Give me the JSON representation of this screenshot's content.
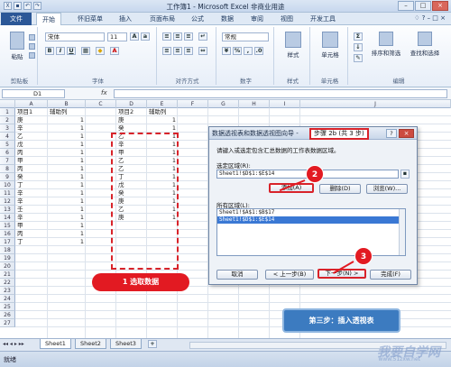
{
  "window": {
    "title": "工作簿1 - Microsoft Excel 非商业用途"
  },
  "ribbon_tabs": [
    "文件",
    "开始",
    "怀旧菜单",
    "插入",
    "页面布局",
    "公式",
    "数据",
    "审阅",
    "视图",
    "开发工具"
  ],
  "ribbon_groups": [
    "剪贴板",
    "字体",
    "对齐方式",
    "数字",
    "样式",
    "单元格",
    "编辑"
  ],
  "ribbon_buttons": {
    "paste": "粘贴",
    "font_name": "宋体",
    "font_size": "11",
    "number_format": "常规",
    "styles": "样式",
    "cells": "单元格",
    "sort_filter": "排序和筛选",
    "find_select": "查找和选择"
  },
  "formula_bar": {
    "name_box": "D1",
    "fx": "fx",
    "content": ""
  },
  "columns": [
    "A",
    "B",
    "C",
    "D",
    "E",
    "F",
    "G",
    "H",
    "I",
    "J"
  ],
  "rows": [
    "1",
    "2",
    "3",
    "4",
    "5",
    "6",
    "7",
    "8",
    "9",
    "10",
    "11",
    "12",
    "13",
    "14",
    "15",
    "16",
    "17",
    "18",
    "19",
    "20",
    "21",
    "22",
    "23",
    "24",
    "25",
    "26",
    "27"
  ],
  "sheet": {
    "a_header": "项目1",
    "b_header": "辅助列",
    "a_values": [
      "庚",
      "辛",
      "乙",
      "戊",
      "丙",
      "甲",
      "丙",
      "癸",
      "丁",
      "辛",
      "辛",
      "壬",
      "辛",
      "甲",
      "丙",
      "丁"
    ],
    "b_values": [
      "1",
      "1",
      "1",
      "1",
      "1",
      "1",
      "1",
      "1",
      "1",
      "1",
      "1",
      "1",
      "1",
      "1",
      "1",
      "1"
    ],
    "d_header": "项目2",
    "e_header": "辅助列",
    "d_values": [
      "庚",
      "癸",
      "乙",
      "辛",
      "甲",
      "乙",
      "乙",
      "丁",
      "戊",
      "癸",
      "庚",
      "乙",
      "庚"
    ],
    "e_values": [
      "1",
      "1",
      "1",
      "1",
      "1",
      "1",
      "1",
      "1",
      "1",
      "1",
      "1",
      "1",
      "1"
    ]
  },
  "annotations": {
    "label1": "1 选取数据",
    "badge2": "2",
    "badge3": "3",
    "step": "第三步：插入透视表"
  },
  "dialog": {
    "title": "数据透视表和数据透视图向导 -",
    "step": "步骤 2b (共 3 步)",
    "help": "?",
    "close": "×",
    "prompt": "请键入或选定包含汇总数据的工作表数据区域。",
    "range_label": "选定区域(R):",
    "range_value": "Sheet1!$D$1:$E$14",
    "add": "添加(A)",
    "delete": "删除(D)",
    "browse": "浏览(W)...",
    "all_ranges_label": "所有区域(L):",
    "all_ranges": [
      "Sheet1!$A$1:$B$17",
      "Sheet1!$D$1:$E$14"
    ],
    "cancel": "取消",
    "back": "< 上一步(B)",
    "next": "下一步(N) >",
    "finish": "完成(F)"
  },
  "sheet_tabs": [
    "Sheet1",
    "Sheet2",
    "Sheet3"
  ],
  "status": "就绪",
  "watermark": "我要自学网",
  "watermark_url": "www.51zxw.net"
}
